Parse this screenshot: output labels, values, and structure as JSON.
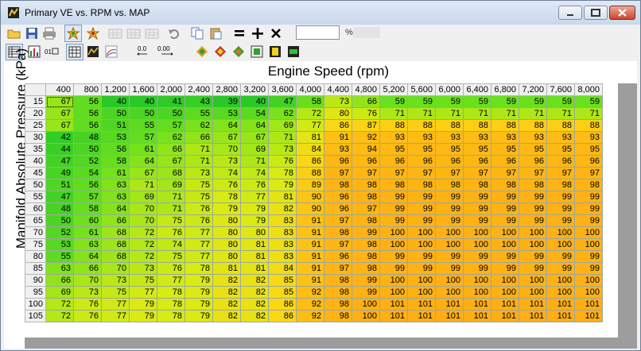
{
  "window": {
    "title": "Primary VE vs. RPM vs. MAP"
  },
  "toolbar": {
    "row1": [
      {
        "name": "open-folder-icon",
        "glyph": "📂"
      },
      {
        "name": "save-icon",
        "glyph": "💾"
      },
      {
        "name": "print-icon",
        "glyph": "🖨"
      },
      {
        "name": "star-burst-icon",
        "glyph": "✱"
      },
      {
        "name": "star-burst-alt-icon",
        "glyph": "✱"
      },
      {
        "name": "table-insert-row-icon",
        "glyph": "▦"
      },
      {
        "name": "table-insert-col-icon",
        "glyph": "▦"
      },
      {
        "name": "table-delete-icon",
        "glyph": "▦"
      },
      {
        "name": "undo-icon",
        "glyph": "↶"
      },
      {
        "name": "copy-icon",
        "glyph": "⧉"
      },
      {
        "name": "paste-icon",
        "glyph": "📋"
      },
      {
        "name": "equals-icon",
        "glyph": "="
      },
      {
        "name": "plus-icon",
        "glyph": "+"
      },
      {
        "name": "multiply-icon",
        "glyph": "✕"
      }
    ],
    "zoom_value": "",
    "zoom_unit": "%",
    "row2": [
      {
        "name": "view-table-icon",
        "glyph": "▤"
      },
      {
        "name": "view-graph-icon",
        "glyph": "▥"
      },
      {
        "name": "view-numeric-icon",
        "glyph": "▧"
      },
      {
        "name": "view-grid-icon",
        "glyph": "▦"
      },
      {
        "name": "view-3d-icon",
        "glyph": "◈"
      },
      {
        "name": "view-contour-icon",
        "glyph": "⊞"
      },
      {
        "name": "decimal-one-icon",
        "glyph": "0.0"
      },
      {
        "name": "decimal-two-icon",
        "glyph": "0.00"
      },
      {
        "name": "color-fill-icon",
        "glyph": "◆"
      },
      {
        "name": "color-fill-2-icon",
        "glyph": "◆"
      },
      {
        "name": "color-fill-3-icon",
        "glyph": "◆"
      },
      {
        "name": "fit-icon",
        "glyph": "⊡"
      },
      {
        "name": "frame-icon",
        "glyph": "▣"
      },
      {
        "name": "frame-2-icon",
        "glyph": "▣"
      }
    ]
  },
  "table": {
    "x_title": "Engine Speed (rpm)",
    "y_title": "Manifold Absolute Pressure (kPa)",
    "rpm": [
      "400",
      "800",
      "1,200",
      "1,600",
      "2,000",
      "2,400",
      "2,800",
      "3,200",
      "3,600",
      "4,000",
      "4,400",
      "4,800",
      "5,200",
      "5,600",
      "6,000",
      "6,400",
      "6,800",
      "7,200",
      "7,600",
      "8,000"
    ],
    "map": [
      "15",
      "20",
      "25",
      "30",
      "35",
      "40",
      "45",
      "50",
      "55",
      "60",
      "65",
      "70",
      "75",
      "80",
      "85",
      "90",
      "95",
      "100",
      "105"
    ],
    "values": [
      [
        67,
        56,
        40,
        40,
        41,
        43,
        39,
        40,
        47,
        58,
        73,
        66,
        59,
        59,
        59,
        59,
        59,
        59,
        59,
        59
      ],
      [
        67,
        56,
        50,
        50,
        50,
        55,
        53,
        54,
        62,
        72,
        80,
        76,
        71,
        71,
        71,
        71,
        71,
        71,
        71,
        71
      ],
      [
        67,
        56,
        51,
        55,
        57,
        62,
        64,
        64,
        69,
        77,
        86,
        87,
        88,
        88,
        88,
        88,
        88,
        88,
        88,
        88
      ],
      [
        42,
        48,
        53,
        57,
        62,
        66,
        67,
        67,
        71,
        81,
        91,
        92,
        93,
        93,
        93,
        93,
        93,
        93,
        93,
        93
      ],
      [
        44,
        50,
        56,
        61,
        66,
        71,
        70,
        69,
        73,
        84,
        93,
        94,
        95,
        95,
        95,
        95,
        95,
        95,
        95,
        95
      ],
      [
        47,
        52,
        58,
        64,
        67,
        71,
        73,
        71,
        76,
        86,
        96,
        96,
        96,
        96,
        96,
        96,
        96,
        96,
        96,
        96
      ],
      [
        49,
        54,
        61,
        67,
        68,
        73,
        74,
        74,
        78,
        88,
        97,
        97,
        97,
        97,
        97,
        97,
        97,
        97,
        97,
        97
      ],
      [
        51,
        56,
        63,
        71,
        69,
        75,
        76,
        76,
        79,
        89,
        98,
        98,
        98,
        98,
        98,
        98,
        98,
        98,
        98,
        98
      ],
      [
        47,
        57,
        63,
        69,
        71,
        75,
        78,
        77,
        81,
        90,
        96,
        98,
        99,
        99,
        99,
        99,
        99,
        99,
        99,
        99
      ],
      [
        48,
        58,
        64,
        70,
        71,
        76,
        79,
        79,
        82,
        90,
        96,
        97,
        99,
        99,
        99,
        99,
        99,
        99,
        99,
        99
      ],
      [
        50,
        60,
        66,
        70,
        75,
        76,
        80,
        79,
        83,
        91,
        97,
        98,
        99,
        99,
        99,
        99,
        99,
        99,
        99,
        99
      ],
      [
        52,
        61,
        68,
        72,
        76,
        77,
        80,
        80,
        83,
        91,
        98,
        99,
        100,
        100,
        100,
        100,
        100,
        100,
        100,
        100
      ],
      [
        53,
        63,
        68,
        72,
        74,
        77,
        80,
        81,
        83,
        91,
        97,
        98,
        100,
        100,
        100,
        100,
        100,
        100,
        100,
        100
      ],
      [
        55,
        64,
        68,
        72,
        75,
        77,
        80,
        81,
        83,
        91,
        96,
        98,
        99,
        99,
        99,
        99,
        99,
        99,
        99,
        99
      ],
      [
        63,
        66,
        70,
        73,
        76,
        78,
        81,
        81,
        84,
        91,
        97,
        98,
        99,
        99,
        99,
        99,
        99,
        99,
        99,
        99
      ],
      [
        66,
        70,
        73,
        75,
        77,
        79,
        82,
        82,
        85,
        91,
        98,
        99,
        100,
        100,
        100,
        100,
        100,
        100,
        100,
        100
      ],
      [
        69,
        73,
        75,
        77,
        78,
        79,
        82,
        82,
        85,
        92,
        98,
        99,
        100,
        100,
        100,
        100,
        100,
        100,
        100,
        100
      ],
      [
        72,
        76,
        77,
        79,
        78,
        79,
        82,
        82,
        86,
        92,
        98,
        100,
        101,
        101,
        101,
        101,
        101,
        101,
        101,
        101
      ],
      [
        72,
        76,
        77,
        79,
        78,
        79,
        82,
        82,
        86,
        92,
        98,
        100,
        101,
        101,
        101,
        101,
        101,
        101,
        101,
        101
      ]
    ]
  }
}
